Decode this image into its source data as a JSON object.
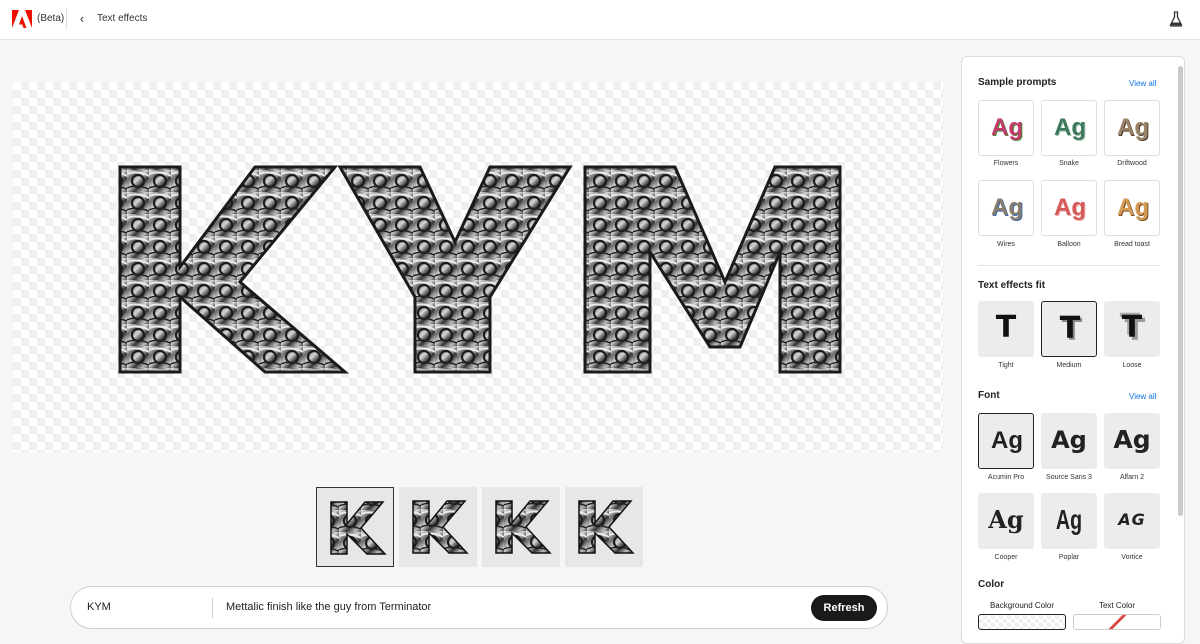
{
  "app": {
    "beta_label": "(Beta)",
    "page_title": "Text effects"
  },
  "canvas": {
    "preview_text": "KYM"
  },
  "thumbnails": [
    {
      "letter": "K",
      "selected": true
    },
    {
      "letter": "K",
      "selected": false
    },
    {
      "letter": "K",
      "selected": false
    },
    {
      "letter": "K",
      "selected": false
    }
  ],
  "prompt": {
    "text_value": "KYM",
    "description_value": "Mettalic finish like the guy from Terminator",
    "refresh_label": "Refresh"
  },
  "panel": {
    "sample_prompts": {
      "title": "Sample prompts",
      "view_all": "View all",
      "items": [
        {
          "label": "Flowers",
          "sample": "Ag"
        },
        {
          "label": "Snake",
          "sample": "Ag"
        },
        {
          "label": "Driftwood",
          "sample": "Ag"
        },
        {
          "label": "Wires",
          "sample": "Ag"
        },
        {
          "label": "Balloon",
          "sample": "Ag"
        },
        {
          "label": "Bread toast",
          "sample": "Ag"
        }
      ]
    },
    "text_effects_fit": {
      "title": "Text effects fit",
      "items": [
        {
          "label": "Tight",
          "glyph": "T"
        },
        {
          "label": "Medium",
          "glyph": "T",
          "selected": true
        },
        {
          "label": "Loose",
          "glyph": "T"
        }
      ]
    },
    "font": {
      "title": "Font",
      "view_all": "View all",
      "items": [
        {
          "label": "Acumin Pro",
          "sample": "Ag",
          "selected": true
        },
        {
          "label": "Source Sans 3",
          "sample": "Ag"
        },
        {
          "label": "Alfarn 2",
          "sample": "Ag"
        },
        {
          "label": "Cooper",
          "sample": "Ag"
        },
        {
          "label": "Poplar",
          "sample": "Ag"
        },
        {
          "label": "Vortice",
          "sample": "AG"
        }
      ]
    },
    "color": {
      "title": "Color",
      "background_label": "Background Color",
      "text_label": "Text Color"
    }
  },
  "colors": {
    "accent_link": "#1473e6",
    "button_dark": "#1a1a1a",
    "adobe_red": "#eb1000"
  }
}
